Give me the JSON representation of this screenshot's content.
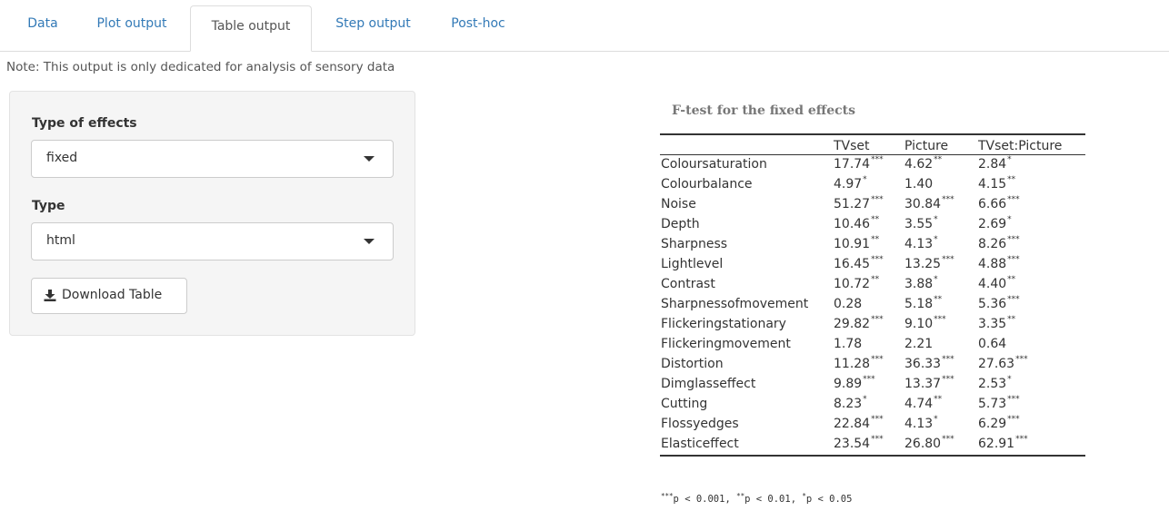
{
  "tabs": [
    {
      "label": "Data",
      "active": false
    },
    {
      "label": "Plot output",
      "active": false
    },
    {
      "label": "Table output",
      "active": true
    },
    {
      "label": "Step output",
      "active": false
    },
    {
      "label": "Post-hoc",
      "active": false
    }
  ],
  "note": "Note: This output is only dedicated for analysis of sensory data",
  "sidebar": {
    "effects_label": "Type of effects",
    "effects_value": "fixed",
    "type_label": "Type",
    "type_value": "html",
    "download_label": "Download Table",
    "download_icon": "download-icon"
  },
  "table": {
    "caption": "F-test for the fixed effects",
    "headers": [
      "TVset",
      "Picture",
      "TVset:Picture"
    ],
    "rows": [
      {
        "label": "Coloursaturation",
        "cells": [
          {
            "v": "17.74",
            "s": "***"
          },
          {
            "v": "4.62",
            "s": "**"
          },
          {
            "v": "2.84",
            "s": "*"
          }
        ]
      },
      {
        "label": "Colourbalance",
        "cells": [
          {
            "v": "4.97",
            "s": "*"
          },
          {
            "v": "1.40",
            "s": ""
          },
          {
            "v": "4.15",
            "s": "**"
          }
        ]
      },
      {
        "label": "Noise",
        "cells": [
          {
            "v": "51.27",
            "s": "***"
          },
          {
            "v": "30.84",
            "s": "***"
          },
          {
            "v": "6.66",
            "s": "***"
          }
        ]
      },
      {
        "label": "Depth",
        "cells": [
          {
            "v": "10.46",
            "s": "**"
          },
          {
            "v": "3.55",
            "s": "*"
          },
          {
            "v": "2.69",
            "s": "*"
          }
        ]
      },
      {
        "label": "Sharpness",
        "cells": [
          {
            "v": "10.91",
            "s": "**"
          },
          {
            "v": "4.13",
            "s": "*"
          },
          {
            "v": "8.26",
            "s": "***"
          }
        ]
      },
      {
        "label": "Lightlevel",
        "cells": [
          {
            "v": "16.45",
            "s": "***"
          },
          {
            "v": "13.25",
            "s": "***"
          },
          {
            "v": "4.88",
            "s": "***"
          }
        ]
      },
      {
        "label": "Contrast",
        "cells": [
          {
            "v": "10.72",
            "s": "**"
          },
          {
            "v": "3.88",
            "s": "*"
          },
          {
            "v": "4.40",
            "s": "**"
          }
        ]
      },
      {
        "label": "Sharpnessofmovement",
        "cells": [
          {
            "v": "0.28",
            "s": ""
          },
          {
            "v": "5.18",
            "s": "**"
          },
          {
            "v": "5.36",
            "s": "***"
          }
        ]
      },
      {
        "label": "Flickeringstationary",
        "cells": [
          {
            "v": "29.82",
            "s": "***"
          },
          {
            "v": "9.10",
            "s": "***"
          },
          {
            "v": "3.35",
            "s": "**"
          }
        ]
      },
      {
        "label": "Flickeringmovement",
        "cells": [
          {
            "v": "1.78",
            "s": ""
          },
          {
            "v": "2.21",
            "s": ""
          },
          {
            "v": "0.64",
            "s": ""
          }
        ]
      },
      {
        "label": "Distortion",
        "cells": [
          {
            "v": "11.28",
            "s": "***"
          },
          {
            "v": "36.33",
            "s": "***"
          },
          {
            "v": "27.63",
            "s": "***"
          }
        ]
      },
      {
        "label": "Dimglasseffect",
        "cells": [
          {
            "v": "9.89",
            "s": "***"
          },
          {
            "v": "13.37",
            "s": "***"
          },
          {
            "v": "2.53",
            "s": "*"
          }
        ]
      },
      {
        "label": "Cutting",
        "cells": [
          {
            "v": "8.23",
            "s": "*"
          },
          {
            "v": "4.74",
            "s": "**"
          },
          {
            "v": "5.73",
            "s": "***"
          }
        ]
      },
      {
        "label": "Flossyedges",
        "cells": [
          {
            "v": "22.84",
            "s": "***"
          },
          {
            "v": "4.13",
            "s": "*"
          },
          {
            "v": "6.29",
            "s": "***"
          }
        ]
      },
      {
        "label": "Elasticeffect",
        "cells": [
          {
            "v": "23.54",
            "s": "***"
          },
          {
            "v": "26.80",
            "s": "***"
          },
          {
            "v": "62.91",
            "s": "***"
          }
        ]
      }
    ],
    "footnote": [
      {
        "sig": "***",
        "text": "p < 0.001, "
      },
      {
        "sig": "**",
        "text": "p < 0.01, "
      },
      {
        "sig": "*",
        "text": "p < 0.05"
      }
    ]
  }
}
